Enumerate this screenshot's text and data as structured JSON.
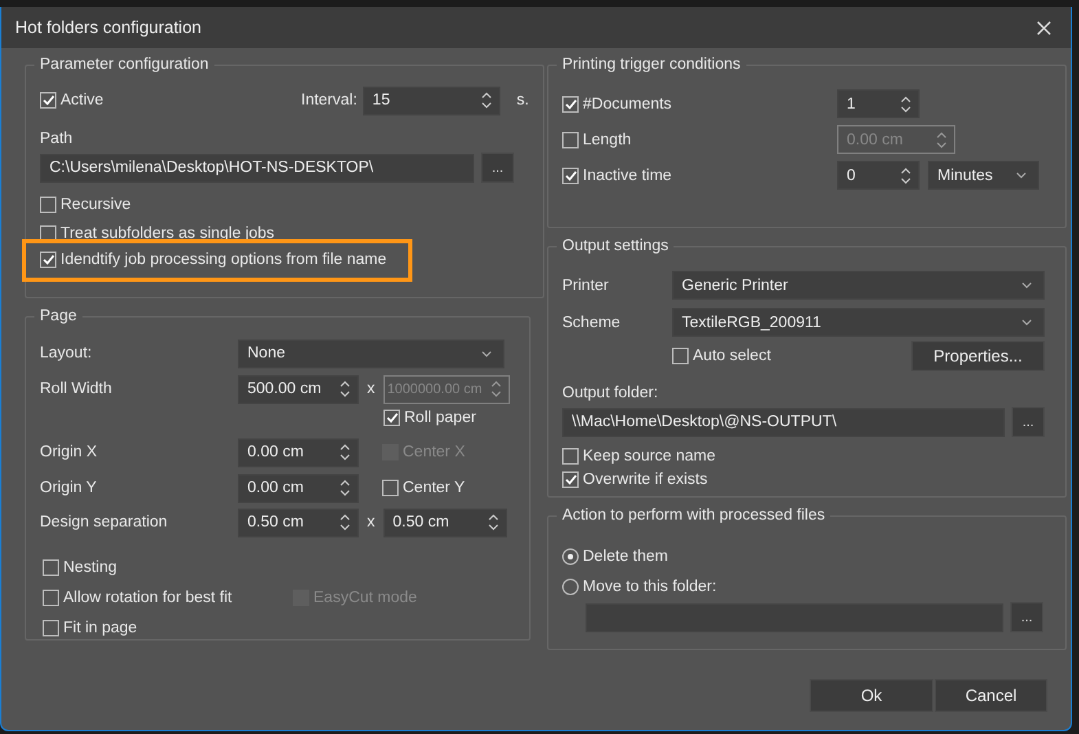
{
  "window": {
    "title": "Hot folders configuration"
  },
  "parameters": {
    "title": "Parameter configuration",
    "active": {
      "label": "Active",
      "checked": true
    },
    "interval": {
      "label": "Interval:",
      "value": "15",
      "unit": "s."
    },
    "path": {
      "label": "Path",
      "value": "C:\\Users\\milena\\Desktop\\HOT-NS-DESKTOP\\",
      "browse": "..."
    },
    "options": [
      {
        "label": "Recursive",
        "checked": false,
        "highlighted": false
      },
      {
        "label": "Treat subfolders as single jobs",
        "checked": false,
        "highlighted": false
      },
      {
        "label": "Idendtify job processing options from file name",
        "checked": true,
        "highlighted": true
      }
    ]
  },
  "page": {
    "title": "Page",
    "layout": {
      "label": "Layout:",
      "value": "None"
    },
    "roll_width": {
      "label": "Roll Width",
      "value": "500.00 cm",
      "sep": "x",
      "length": "1000000.00 cm",
      "length_disabled": true
    },
    "roll_paper": {
      "label": "Roll paper",
      "checked": true
    },
    "origin_x": {
      "label": "Origin X",
      "value": "0.00 cm",
      "center": {
        "label": "Center X",
        "checked": false,
        "disabled": true
      }
    },
    "origin_y": {
      "label": "Origin Y",
      "value": "0.00 cm",
      "center": {
        "label": "Center Y",
        "checked": false,
        "disabled": false
      }
    },
    "separation": {
      "label": "Design separation",
      "value_x": "0.50 cm",
      "sep": "x",
      "value_y": "0.50 cm"
    },
    "options": [
      {
        "label": "Nesting",
        "checked": false,
        "disabled": false
      },
      {
        "label": "Allow rotation for best fit",
        "checked": false,
        "disabled": false
      },
      {
        "label": "EasyCut mode",
        "checked": false,
        "disabled": true
      },
      {
        "label": "Fit in page",
        "checked": false,
        "disabled": false
      }
    ]
  },
  "trigger": {
    "title": "Printing trigger conditions",
    "rows": [
      {
        "label": "#Documents",
        "checked": true,
        "value": "1",
        "disabled": false
      },
      {
        "label": "Length",
        "checked": false,
        "value": "0.00 cm",
        "disabled": true
      },
      {
        "label": "Inactive time",
        "checked": true,
        "value": "0",
        "disabled": false,
        "unit": "Minutes"
      }
    ]
  },
  "output": {
    "title": "Output settings",
    "printer": {
      "label": "Printer",
      "value": "Generic Printer"
    },
    "scheme": {
      "label": "Scheme",
      "value": "TextileRGB_200911"
    },
    "auto_select": {
      "label": "Auto select",
      "checked": false
    },
    "properties": "Properties...",
    "folder": {
      "label": "Output folder:",
      "value": "\\\\Mac\\Home\\Desktop\\@NS-OUTPUT\\",
      "browse": "..."
    },
    "options": [
      {
        "label": "Keep source name",
        "checked": false
      },
      {
        "label": "Overwrite if exists",
        "checked": true
      }
    ]
  },
  "action": {
    "title": "Action to perform with processed files",
    "choices": [
      {
        "label": "Delete them",
        "selected": true
      },
      {
        "label": "Move to this folder:",
        "selected": false
      }
    ],
    "folder_browse": "..."
  },
  "buttons": [
    "Ok",
    "Cancel"
  ]
}
